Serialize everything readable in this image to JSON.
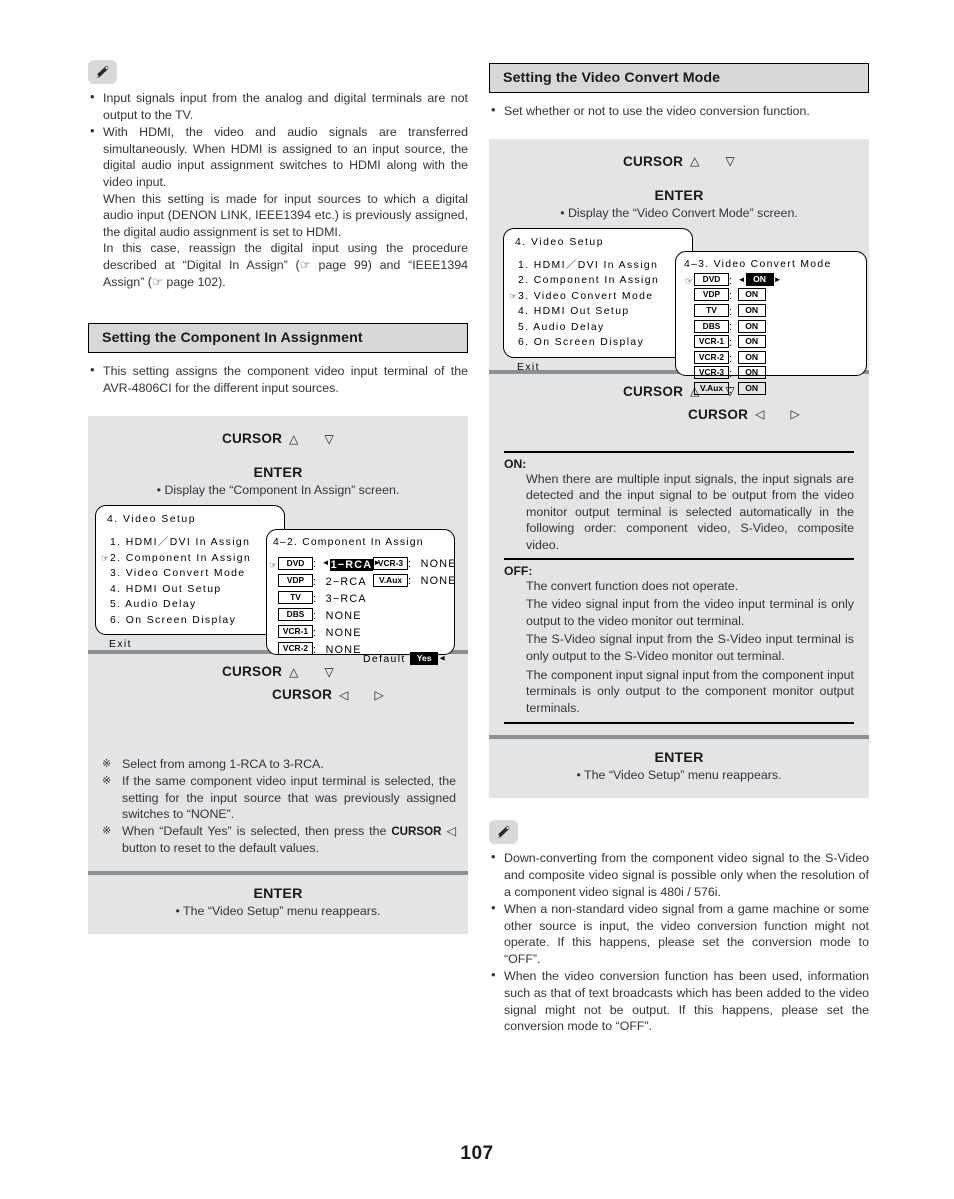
{
  "page": {
    "number": "107"
  },
  "icons": {
    "note": "pencil-icon",
    "page_ref": "pointing-hand-icon"
  },
  "left": {
    "note": {
      "items": [
        "Input signals input from the analog and digital terminals are not output to the TV.",
        "With HDMI, the video and audio signals are transferred simultaneously. When HDMI is assigned to an input source, the digital audio input assignment switches to HDMI along with the video input.",
        "When this setting is made for input sources to which a digital audio input (DENON LINK, IEEE1394 etc.) is previously assigned, the digital audio assignment is set to HDMI.",
        "In this case, reassign the digital input using the procedure described at “Digital In Assign” (☞ page 99) and “IEEE1394 Assign” (☞ page 102)."
      ]
    },
    "section": {
      "heading": "Setting the Component In Assignment",
      "intro": "This setting assigns the component video input terminal of the AVR-4806CI for the different input sources."
    },
    "op1": {
      "cursor_label": "CURSOR",
      "up": "△",
      "down": "▽",
      "enter_label": "ENTER",
      "enter_desc": "• Display the “Component In Assign” screen."
    },
    "osd_menu": {
      "title": "4. Video Setup",
      "items": [
        {
          "marker": "",
          "label": "1. HDMI／DVI In Assign"
        },
        {
          "marker": "☞",
          "label": "2. Component In Assign"
        },
        {
          "marker": "",
          "label": "3. Video Convert Mode"
        },
        {
          "marker": "",
          "label": "4. HDMI Out Setup"
        },
        {
          "marker": "",
          "label": "5. Audio Delay"
        },
        {
          "marker": "",
          "label": "6. On Screen Display"
        }
      ],
      "exit": "Exit"
    },
    "osd_assign": {
      "title": "4–2. Component In Assign",
      "left_rows": [
        {
          "tag": "DVD",
          "value": "1−RCA",
          "selected": true
        },
        {
          "tag": "VDP",
          "value": "2−RCA",
          "selected": false
        },
        {
          "tag": "TV",
          "value": "3−RCA",
          "selected": false
        },
        {
          "tag": "DBS",
          "value": "NONE",
          "selected": false
        },
        {
          "tag": "VCR-1",
          "value": "NONE",
          "selected": false
        },
        {
          "tag": "VCR-2",
          "value": "NONE",
          "selected": false
        }
      ],
      "right_rows": [
        {
          "tag": "VCR-3",
          "value": "NONE"
        },
        {
          "tag": "V.Aux",
          "value": "NONE"
        }
      ],
      "default_label": "Default",
      "default_value": "Yes"
    },
    "op2": {
      "cursor_label": "CURSOR",
      "up": "△",
      "down": "▽",
      "left": "◁",
      "right": "▷",
      "notes": [
        "Select from among 1-RCA to 3-RCA.",
        "If the same component video input terminal is selected, the setting for the input source that was previously assigned switches to “NONE”.",
        "When “Default Yes” is selected, then press the CURSOR ◁ button to reset to the default values."
      ],
      "note3_prefix": "When “Default Yes” is selected, then press the ",
      "note3_bold": "CURSOR",
      "note3_arrow": "◁",
      "note3_suffix": " button to reset to the default values."
    },
    "op3": {
      "enter_label": "ENTER",
      "enter_desc": "• The “Video Setup” menu reappears."
    }
  },
  "right": {
    "section": {
      "heading": "Setting the Video Convert Mode",
      "intro": "Set whether or not to use the video conversion function."
    },
    "op1": {
      "cursor_label": "CURSOR",
      "up": "△",
      "down": "▽",
      "enter_label": "ENTER",
      "enter_desc": "• Display the “Video Convert Mode” screen."
    },
    "osd_menu": {
      "title": "4. Video Setup",
      "items": [
        {
          "marker": "",
          "label": "1. HDMI／DVI In Assign"
        },
        {
          "marker": "",
          "label": "2. Component In Assign"
        },
        {
          "marker": "☞",
          "label": "3. Video Convert Mode"
        },
        {
          "marker": "",
          "label": "4. HDMI Out Setup"
        },
        {
          "marker": "",
          "label": "5. Audio Delay"
        },
        {
          "marker": "",
          "label": "6. On Screen Display"
        }
      ],
      "exit": "Exit"
    },
    "osd_convert": {
      "title": "4–3. Video Convert Mode",
      "rows": [
        {
          "tag": "DVD",
          "value": "ON",
          "selected": true
        },
        {
          "tag": "VDP",
          "value": "ON",
          "selected": false
        },
        {
          "tag": "TV",
          "value": "ON",
          "selected": false
        },
        {
          "tag": "DBS",
          "value": "ON",
          "selected": false
        },
        {
          "tag": "VCR-1",
          "value": "ON",
          "selected": false
        },
        {
          "tag": "VCR-2",
          "value": "ON",
          "selected": false
        },
        {
          "tag": "VCR-3",
          "value": "ON",
          "selected": false
        },
        {
          "tag": "V.Aux",
          "value": "ON",
          "selected": false
        }
      ]
    },
    "op2": {
      "cursor_label": "CURSOR",
      "up": "△",
      "down": "▽",
      "left": "◁",
      "right": "▷"
    },
    "definitions": [
      {
        "term": "ON:",
        "lines": [
          "When there are multiple input signals, the input signals are detected and the input signal to be output from the video monitor output terminal is selected automatically in the following order: component video, S-Video, composite video."
        ]
      },
      {
        "term": "OFF:",
        "lines": [
          "The convert function does not operate.",
          "The video signal input from the video input terminal is only output to the video monitor out terminal.",
          "The S-Video signal input from the S-Video input terminal is only output to the S-Video monitor out terminal.",
          "The component input signal input from the component input terminals is only output to the component monitor output terminals."
        ]
      }
    ],
    "op3": {
      "enter_label": "ENTER",
      "enter_desc": "• The “Video Setup” menu reappears."
    },
    "note": {
      "items": [
        "Down-converting from the component video signal to the S-Video and composite video signal is possible only when the resolution of a component video signal is 480i / 576i.",
        "When a non-standard video signal from a game machine or some other source is input, the video conversion function might not operate. If this happens, please set the conversion mode to “OFF”.",
        "When the video conversion function has been used, information such as that of text broadcasts which has been added to the video signal might not be output. If this happens, please set the conversion mode to “OFF”."
      ]
    }
  }
}
